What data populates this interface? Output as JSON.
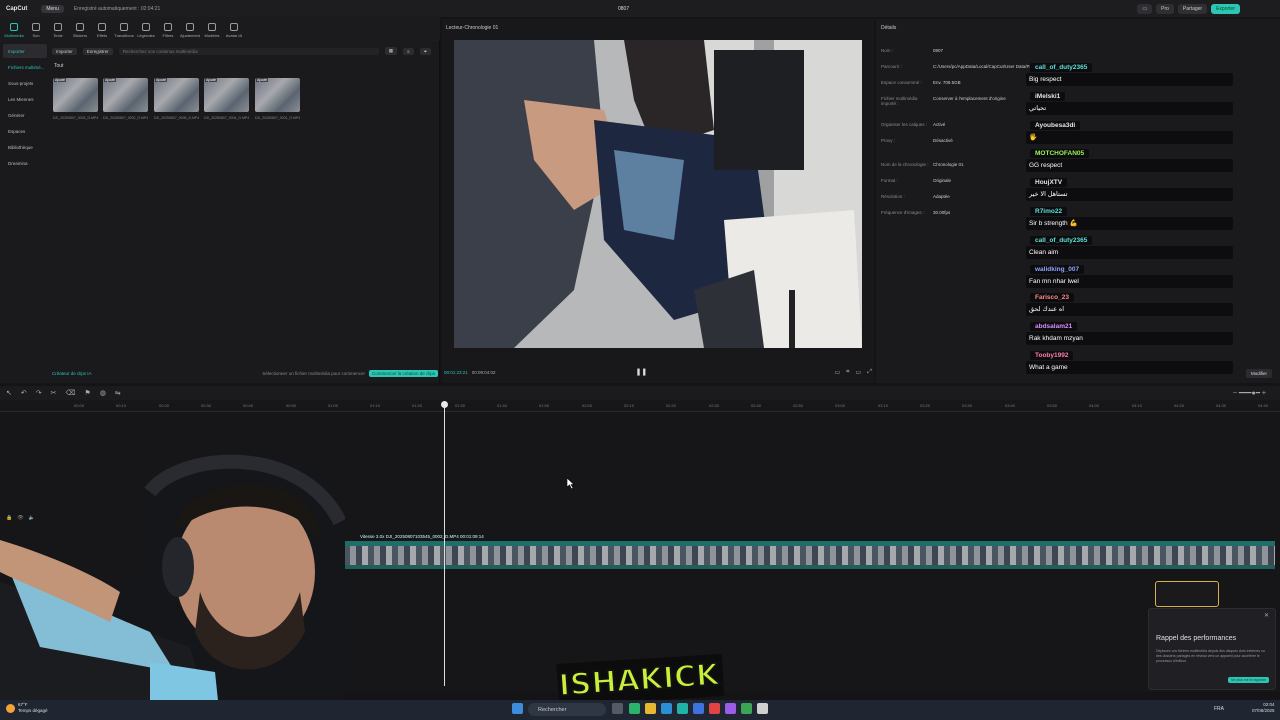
{
  "titlebar": {
    "app_name": "CapCut",
    "menu_label": "Menu",
    "saved_status": "Enregistré automatiquement : 02:04:21",
    "document_title": "0807",
    "pro_label": "Pro",
    "share_label": "Partager",
    "export_label": "Exporter"
  },
  "tools": [
    {
      "label": "Multimédia"
    },
    {
      "label": "Son"
    },
    {
      "label": "Texte"
    },
    {
      "label": "Stickers"
    },
    {
      "label": "Effets"
    },
    {
      "label": "Transitions"
    },
    {
      "label": "Légendes"
    },
    {
      "label": "Filtres"
    },
    {
      "label": "Ajustement"
    },
    {
      "label": "Modèles"
    },
    {
      "label": "Avatar IA"
    }
  ],
  "media_sidebar": [
    {
      "label": "Importer"
    },
    {
      "label": "Fichiers multimé..."
    },
    {
      "label": "Sous-projets"
    },
    {
      "label": "Les Miennes"
    },
    {
      "label": "Générer"
    },
    {
      "label": "Espaces"
    },
    {
      "label": "Bibliothèque"
    },
    {
      "label": "Dreamina"
    }
  ],
  "media_header": {
    "import_label": "Importer",
    "record_label": "Enregistrer",
    "search_placeholder": "Recherchez vos contenus multimédia"
  },
  "media_filter": "Tout",
  "media_items": [
    {
      "tag": "Ajouté",
      "caption": "DJI_20250807_0003_D.MP4"
    },
    {
      "tag": "Ajouté",
      "caption": "DJI_20250807_0002_D.MP4"
    },
    {
      "tag": "Ajouté",
      "caption": "DJI_20250807_0005_D.MP4"
    },
    {
      "tag": "Ajouté",
      "caption": "DJI_20250807_0004_D.MP4"
    },
    {
      "tag": "Ajouté",
      "caption": "DJI_20250807_0001_D.MP4"
    }
  ],
  "media_footer": {
    "clip_creator": "Créateur de clips IA",
    "hint": "Sélectionner un fichier multimédia pour commencer",
    "start_button": "Commencer la création de clips"
  },
  "player": {
    "title": "Lecteur-Chronologie 01",
    "current_time": "00:01:23:21",
    "total_time": "00:09:04:02"
  },
  "details": {
    "title": "Détails",
    "rows": [
      {
        "key": "Nom :",
        "value": "0807"
      },
      {
        "key": "Parcourir :",
        "value": "C:/Users/pc/AppData/Local/CapCut/User Data/P..."
      },
      {
        "key": "Espace consommé :",
        "value": "Env. 709.5GB"
      },
      {
        "key": "Fichier multimédia importé :",
        "value": "Conserver à l'emplacement d'origine"
      },
      {
        "key": "Organiser les calques :",
        "value": "Activé"
      },
      {
        "key": "Proxy :",
        "value": "Désactivé"
      },
      {
        "key": "Nom de la chronologie :",
        "value": "Chronologie 01"
      },
      {
        "key": "Format :",
        "value": "Originale"
      },
      {
        "key": "Résolution :",
        "value": "Adaptée"
      },
      {
        "key": "Fréquence d'images :",
        "value": "30.00fps"
      }
    ],
    "modify_button": "Modifier"
  },
  "chat": [
    {
      "user": "call_of_duty2365",
      "color": "#5ee0d8",
      "message": "Big respect"
    },
    {
      "user": "iMelski1",
      "color": "#e6e6e6",
      "message": "تحياتي"
    },
    {
      "user": "Ayoubesa3di",
      "color": "#e6e6e6",
      "message": "🖐"
    },
    {
      "user": "MOTCHOFAN05",
      "color": "#9cf25a",
      "message": "GG respect"
    },
    {
      "user": "HoujXTV",
      "color": "#e6e6e6",
      "message": "تستاهل الا خير"
    },
    {
      "user": "R7imo22",
      "color": "#5ee0d8",
      "message": "Sir b strength 💪"
    },
    {
      "user": "call_of_duty2365",
      "color": "#5ee0d8",
      "message": "Clean aim"
    },
    {
      "user": "walidking_007",
      "color": "#8fa4ff",
      "message": "Fan mn nhar lwel"
    },
    {
      "user": "Farisco_23",
      "color": "#ff8a8a",
      "message": "اه عندك لحق"
    },
    {
      "user": "abdsalam21",
      "color": "#d98cff",
      "message": "Rak khdam mzyan"
    },
    {
      "user": "Tooby1992",
      "color": "#ff7fa8",
      "message": "What a game"
    }
  ],
  "timeline": {
    "clip_label": "Vitesse 3.0x  DJI_20250807103545_0002_D.MP4  00:01:09:14",
    "ruler_ticks": [
      "00:00",
      "00:10",
      "00:20",
      "00:30",
      "00:40",
      "00:50",
      "01:00",
      "01:10",
      "01:20",
      "01:30",
      "01:40",
      "01:50",
      "02:00",
      "02:10",
      "02:20",
      "02:30",
      "02:40",
      "02:50",
      "03:00",
      "03:10",
      "03:20",
      "03:30",
      "03:40",
      "03:50",
      "04:00",
      "04:10",
      "04:20",
      "04:30",
      "04:40",
      "04:50"
    ]
  },
  "notification": {
    "title": "Rappel des performances",
    "body": "Déplacez vos fichiers multimédia depuis des disques durs externes ou des dossiers partagés en réseau vers un appareil pour accélérer le processus d'édition.",
    "button": "Ne plus me le rappeler"
  },
  "brand": {
    "text": "ISHAKICK"
  },
  "taskbar": {
    "weather_temp": "67°F",
    "weather_desc": "Temps dégagé",
    "search_label": "Rechercher",
    "language": "FRA",
    "time": "02:04",
    "date": "07/08/2025"
  },
  "colors": {
    "accent": "#2ec4b6",
    "background": "#141416",
    "panel": "#1a1a1d"
  }
}
